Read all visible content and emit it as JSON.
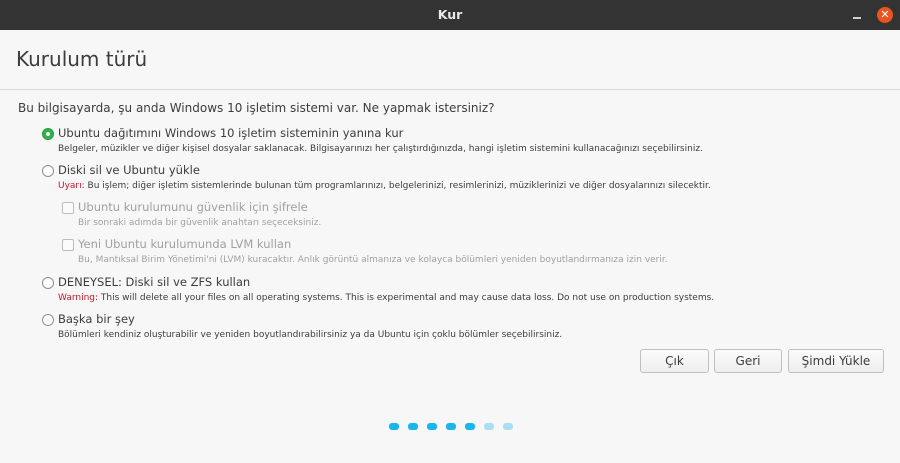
{
  "window": {
    "title": "Kur",
    "minimize_icon": "minimize-icon",
    "close_icon": "close-icon"
  },
  "page": {
    "title": "Kurulum türü"
  },
  "question": "Bu bilgisayarda, şu anda Windows 10 işletim sistemi var. Ne yapmak istersiniz?",
  "options": [
    {
      "label": "Ubuntu dağıtımını Windows 10 işletim sisteminin yanına kur",
      "description": "Belgeler, müzikler ve diğer kişisel dosyalar saklanacak. Bilgisayarınızı her çalıştırdığınızda, hangi işletim sistemini kullanacağınızı seçebilirsiniz.",
      "selected": true
    },
    {
      "label": "Diski sil ve Ubuntu yükle",
      "warning_prefix": "Uyarı:",
      "description": " Bu işlem; diğer işletim sistemlerinde bulunan tüm programlarınızı, belgelerinizi, resimlerinizi, müziklerinizi ve diğer dosyalarınızı silecektir.",
      "selected": false
    },
    {
      "label": "DENEYSEL: Diski sil ve ZFS kullan",
      "warning_prefix": "Warning:",
      "description": " This will delete all your files on all operating systems. This is experimental and may cause data loss. Do not use on production systems.",
      "selected": false
    },
    {
      "label": "Başka bir şey",
      "description": "Bölümleri kendiniz oluşturabilir ve yeniden boyutlandırabilirsiniz ya da Ubuntu için çoklu bölümler seçebilirsiniz.",
      "selected": false
    }
  ],
  "suboptions": [
    {
      "label": "Ubuntu kurulumunu güvenlik için şifrele",
      "description": "Bir sonraki adımda bir güvenlik anahtarı seçeceksiniz.",
      "checked": false,
      "enabled": false
    },
    {
      "label": "Yeni Ubuntu kurulumunda LVM kullan",
      "description": "Bu, Mantıksal Birim Yönetimi'ni (LVM) kuracaktır. Anlık görüntü almanıza ve kolayca bölümleri yeniden boyutlandırmanıza izin verir.",
      "checked": false,
      "enabled": false
    }
  ],
  "buttons": {
    "quit": "Çık",
    "back": "Geri",
    "install_now": "Şimdi Yükle"
  },
  "progress": {
    "total_steps": 7,
    "completed_steps": 5
  },
  "colors": {
    "accent": "#e95420",
    "radio_selected": "#2fb34a",
    "warning": "#c7162b",
    "progress_on": "#19b6ee",
    "progress_off": "#a9dff3"
  }
}
